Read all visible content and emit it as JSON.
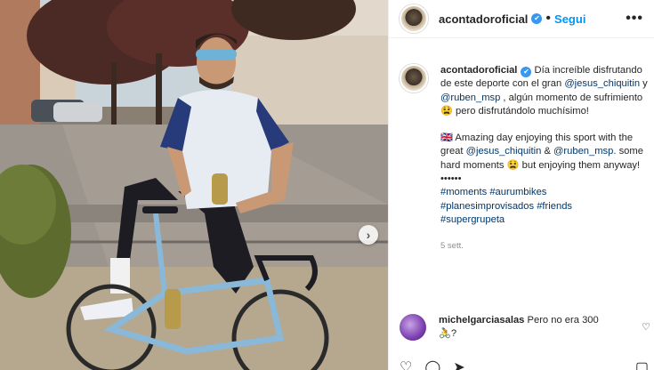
{
  "post": {
    "username": "acontadoroficial",
    "dot": "•",
    "follow_label": "Segui",
    "more_label": "•••"
  },
  "caption": {
    "username": "acontadoroficial",
    "es_1": "Día increíble disfrutando de este deporte con el gran ",
    "mention_1": "@jesus_chiquitin",
    "es_2": " y ",
    "mention_2": "@ruben_msp",
    "es_3": " , algún momento de sufrimiento 😫 pero disfrutándolo muchísimo!",
    "en_1": "🇬🇧 Amazing day enjoying this sport with the great ",
    "mention_3": "@jesus_chiquitin",
    "en_2": " & ",
    "mention_4": "@ruben_msp",
    "en_3": ". some hard moments 😫 but enjoying them anyway!",
    "dots": "••••••",
    "hashtags_1": "#moments #aurumbikes",
    "hashtags_2": "#planesimprovisados #friends",
    "hashtags_3": "#supergrupeta",
    "time": "5 sett."
  },
  "comment": {
    "username": "michelgarciasalas",
    "text": " Pero no era 300 🚴?"
  },
  "icons": {
    "verified": "✔",
    "heart": "♡",
    "comment": "◯",
    "share": "➤",
    "bookmark": "▢",
    "next": "›"
  },
  "colors": {
    "link": "#00376b",
    "follow": "#0095f6",
    "verified": "#3897f0"
  }
}
